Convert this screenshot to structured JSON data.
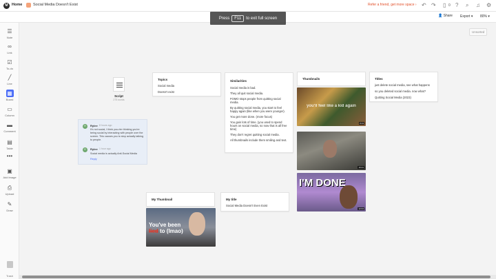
{
  "app": {
    "home_label": "Home",
    "doc_title": "Social Media Doesn't Exist",
    "refer_link": "Refer a friend, get more space ›",
    "notifications_count": "0",
    "share_label": "Share",
    "export_label": "Export",
    "zoom_label": "80%",
    "unsorted_label": "Unsorted"
  },
  "toast": {
    "prefix": "Press",
    "key": "F11",
    "suffix": "to exit full screen"
  },
  "sidebar": {
    "items": [
      {
        "label": "Note",
        "icon": "note-icon"
      },
      {
        "label": "Link",
        "icon": "link-icon"
      },
      {
        "label": "To-do",
        "icon": "todo-icon"
      },
      {
        "label": "Line",
        "icon": "line-icon"
      },
      {
        "label": "Board",
        "icon": "board-icon"
      },
      {
        "label": "Column",
        "icon": "column-icon"
      },
      {
        "label": "Comment",
        "icon": "comment-icon"
      },
      {
        "label": "Table",
        "icon": "table-icon"
      },
      {
        "label": "",
        "icon": "more-icon"
      },
      {
        "label": "Add image",
        "icon": "image-icon"
      },
      {
        "label": "Upload",
        "icon": "upload-icon"
      },
      {
        "label": "Draw",
        "icon": "draw-icon"
      }
    ],
    "trash_label": "Trash"
  },
  "script": {
    "name": "Script",
    "words": "275 words"
  },
  "comments": [
    {
      "author": "Rylee",
      "time": "8 hours ago",
      "text": "It's not social, I think you-rter thinking you're being social by interacting with people over the screen. This causes you to stop actually talking to people."
    },
    {
      "author": "Rylee",
      "time": "1 hour ago",
      "text": "Social media is actually Anti-Social Media"
    }
  ],
  "comment_reply": "Reply",
  "topics": {
    "title": "Topics",
    "items": [
      "Social media",
      "Doesn't exist"
    ]
  },
  "similarities": {
    "title": "Similarities",
    "items": [
      "Social media is bad.",
      "They all quit social media.",
      "FOMO stops people from quitting social media.",
      "By quitting social media, you start to feel happy again (like when you were younger).",
      "You get more done. (more focus)",
      "You gain lots of time. (you used to spend hours on social media, so now that is all free time)",
      "They don't regret quitting social media.",
      "All thumbnails include them smiling and text."
    ]
  },
  "thumbnails": {
    "title": "Thumbnails",
    "items": [
      {
        "caption": "you'll feel like a kid again",
        "duration": "8:13"
      },
      {
        "caption": "",
        "duration": "10:21"
      },
      {
        "caption": "I'M DONE",
        "duration": "12:04"
      }
    ]
  },
  "titles": {
    "title": "Titles",
    "items": [
      "just delete social media, see what happens",
      "so you deleted social media. now what?",
      "Quitting Social Media (2023)"
    ]
  },
  "my_thumbnail": {
    "title": "My Thumbnail",
    "caption_top": "You've been",
    "caption_strike": "lied",
    "caption_bottom": "to (lmao)"
  },
  "my_title": {
    "title": "My title",
    "text": "Social Media Doesn't Even Exist"
  }
}
